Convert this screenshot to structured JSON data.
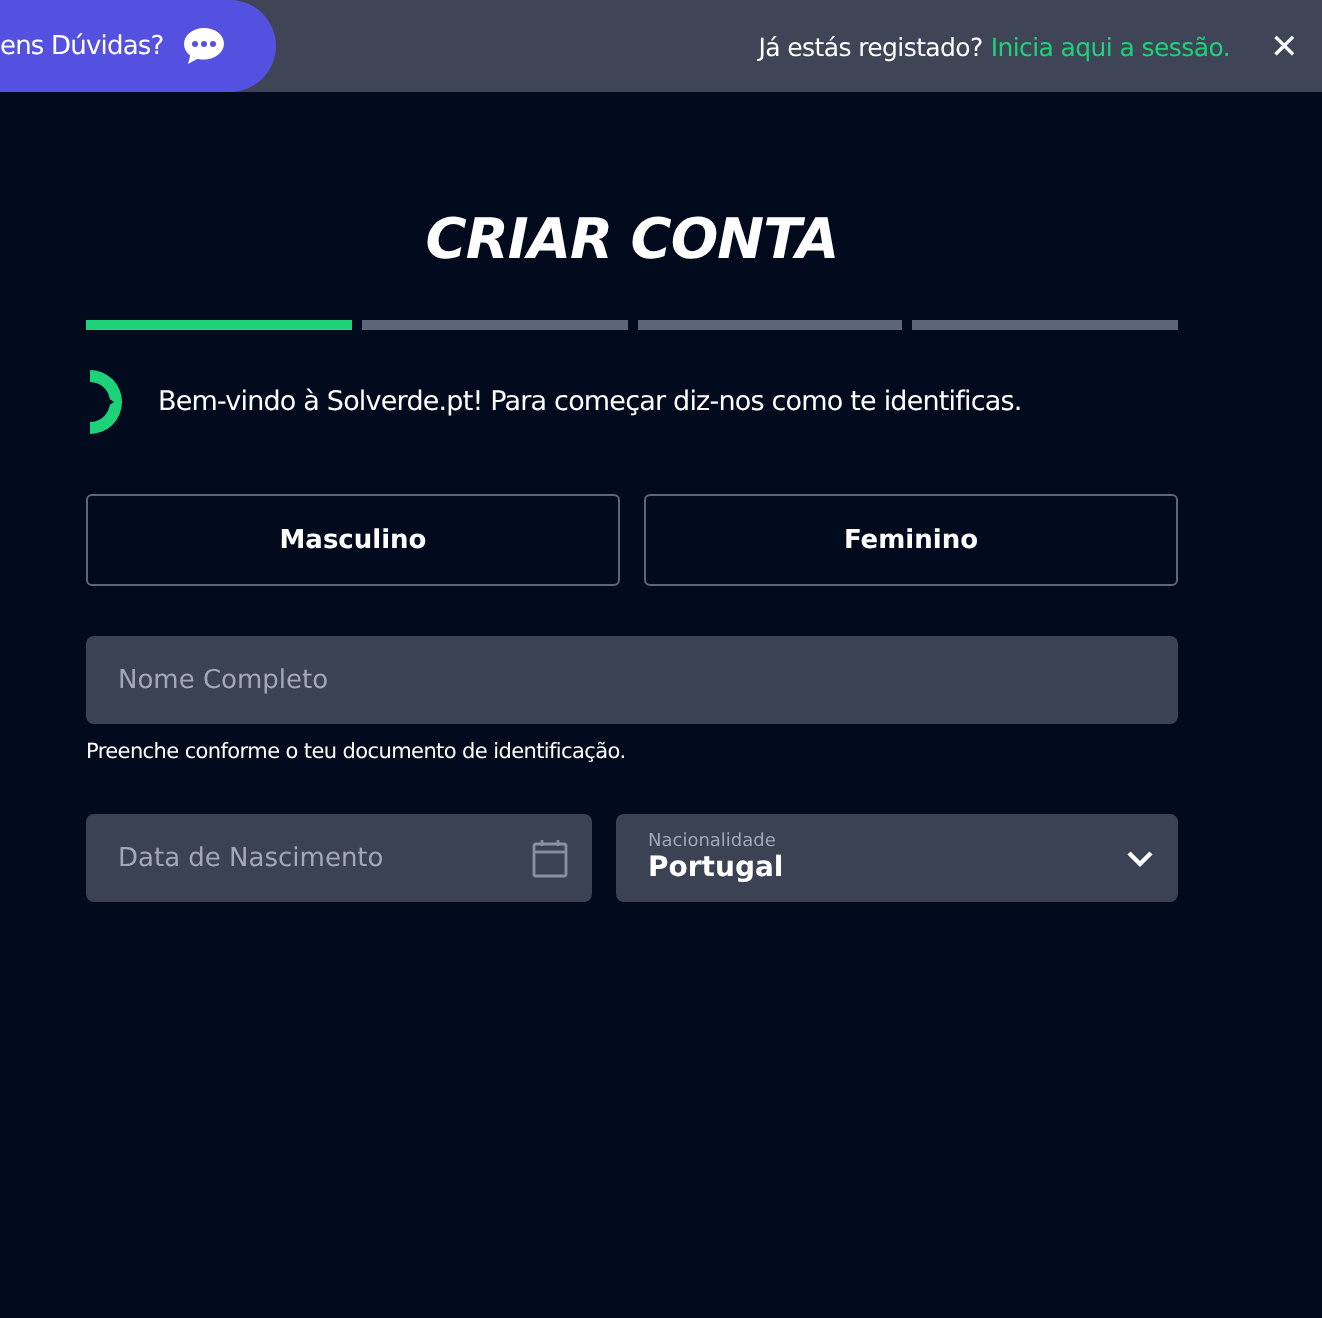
{
  "top_bar": {
    "help": "ens Dúvidas?",
    "login_prompt": "Já estás registado?",
    "login_link": "Inicia aqui a sessão.",
    "close": "✕"
  },
  "title": "CRIAR CONTA",
  "steps": [
    {
      "active": true
    },
    {
      "active": false
    },
    {
      "active": false
    },
    {
      "active": false
    }
  ],
  "welcome": "Bem-vindo à Solverde.pt! Para começar diz-nos como te identificas.",
  "gender": [
    {
      "label": "Masculino",
      "selected": false
    },
    {
      "label": "Feminino",
      "selected": false
    }
  ],
  "full_name": {
    "placeholder": "Nome Completo",
    "hint": "Preenche conforme o teu documento de identificação."
  },
  "birth_date": {
    "placeholder": "Data de Nascimento"
  },
  "nationality": {
    "label": "Nacionalidade",
    "value": "Portugal"
  }
}
